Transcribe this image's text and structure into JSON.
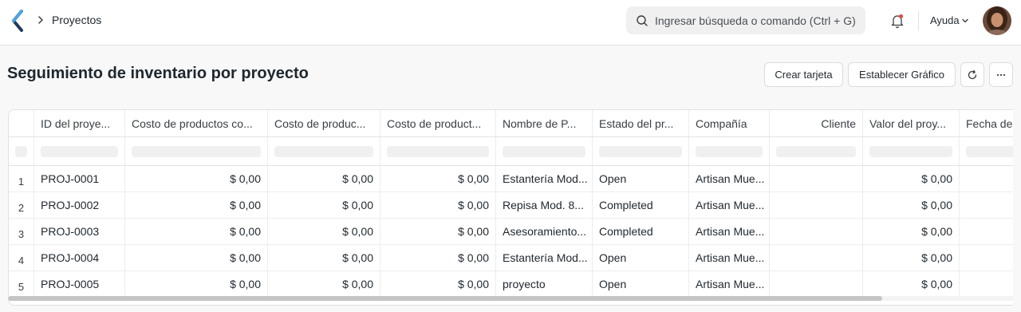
{
  "navbar": {
    "breadcrumb": "Proyectos",
    "search_placeholder": "Ingresar búsqueda o comando (Ctrl + G)",
    "help_label": "Ayuda"
  },
  "page": {
    "title": "Seguimiento de inventario por proyecto",
    "create_card_label": "Crear tarjeta",
    "set_chart_label": "Establecer Gráfico"
  },
  "table": {
    "columns": [
      "ID del proye...",
      "Costo de productos co...",
      "Costo de produc...",
      "Costo de product...",
      "Nombre de P...",
      "Estado del pr...",
      "Compañía",
      "Cliente",
      "Valor del proy...",
      "Fecha de"
    ],
    "rows": [
      {
        "idx": "1",
        "id": "PROJ-0001",
        "c1": "$ 0,00",
        "c2": "$ 0,00",
        "c3": "$ 0,00",
        "name": "Estantería Mod...",
        "status": "Open",
        "company": "Artisan Mue...",
        "customer": "",
        "value": "$ 0,00",
        "date": ""
      },
      {
        "idx": "2",
        "id": "PROJ-0002",
        "c1": "$ 0,00",
        "c2": "$ 0,00",
        "c3": "$ 0,00",
        "name": "Repisa Mod. 8...",
        "status": "Completed",
        "company": "Artisan Mue...",
        "customer": "",
        "value": "$ 0,00",
        "date": ""
      },
      {
        "idx": "3",
        "id": "PROJ-0003",
        "c1": "$ 0,00",
        "c2": "$ 0,00",
        "c3": "$ 0,00",
        "name": "Asesoramiento...",
        "status": "Completed",
        "company": "Artisan Mue...",
        "customer": "",
        "value": "$ 0,00",
        "date": ""
      },
      {
        "idx": "4",
        "id": "PROJ-0004",
        "c1": "$ 0,00",
        "c2": "$ 0,00",
        "c3": "$ 0,00",
        "name": "Estantería Mod...",
        "status": "Open",
        "company": "Artisan Mue...",
        "customer": "",
        "value": "$ 0,00",
        "date": ""
      },
      {
        "idx": "5",
        "id": "PROJ-0005",
        "c1": "$ 0,00",
        "c2": "$ 0,00",
        "c3": "$ 0,00",
        "name": "proyecto",
        "status": "Open",
        "company": "Artisan Mue...",
        "customer": "",
        "value": "$ 0,00",
        "date": ""
      }
    ]
  },
  "colors": {
    "accent": "#2490ef",
    "logo_dark": "#1f3a5f",
    "logo_light": "#4fa3e0",
    "notification": "#e24c4c"
  },
  "icons": {
    "logo": "frappe-logo",
    "breadcrumb": "chevron-right-icon",
    "search": "search-icon",
    "notifications": "bell-icon",
    "help_dropdown": "chevron-down-icon",
    "refresh": "refresh-icon",
    "more": "more-horizontal-icon"
  }
}
